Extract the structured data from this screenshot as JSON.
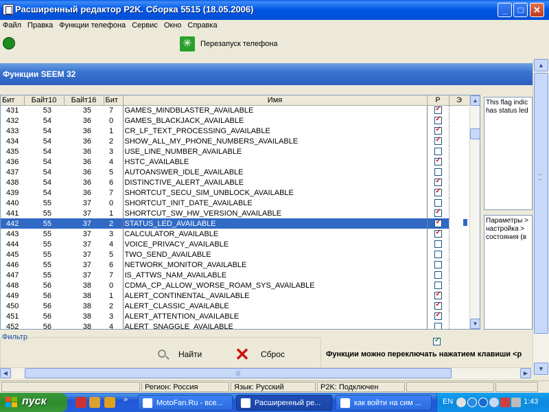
{
  "window": {
    "title": "Расширенный редактор P2K. Сборка 5515 (18.05.2006)",
    "minimize_glyph": "_",
    "maximize_glyph": "□",
    "close_glyph": "✕"
  },
  "menu": [
    "Файл",
    "Правка",
    "Функции телефона",
    "Сервис",
    "Окно",
    "Справка"
  ],
  "toolbar": {
    "restart_label": "Перезапуск телефона"
  },
  "panel_title": "Функции SEEM 32",
  "table": {
    "headers": [
      "Бит",
      "Байт10",
      "Байт16",
      "Бит",
      "Имя",
      "Р",
      "Э"
    ],
    "rows": [
      {
        "bit": "431",
        "byte10": "53",
        "byte16": "35",
        "b": "7",
        "name": "GAMES_MINDBLASTER_AVAILABLE",
        "p": true,
        "e": false
      },
      {
        "bit": "432",
        "byte10": "54",
        "byte16": "36",
        "b": "0",
        "name": "GAMES_BLACKJACK_AVAILABLE",
        "p": true,
        "e": false
      },
      {
        "bit": "433",
        "byte10": "54",
        "byte16": "36",
        "b": "1",
        "name": "CR_LF_TEXT_PROCESSING_AVAILABLE",
        "p": true,
        "e": false
      },
      {
        "bit": "434",
        "byte10": "54",
        "byte16": "36",
        "b": "2",
        "name": "SHOW_ALL_MY_PHONE_NUMBERS_AVAILABLE",
        "p": true,
        "e": false
      },
      {
        "bit": "435",
        "byte10": "54",
        "byte16": "36",
        "b": "3",
        "name": "USE_LINE_NUMBER_AVAILABLE",
        "p": false,
        "e": false
      },
      {
        "bit": "436",
        "byte10": "54",
        "byte16": "36",
        "b": "4",
        "name": "HSTC_AVAILABLE",
        "p": true,
        "e": false
      },
      {
        "bit": "437",
        "byte10": "54",
        "byte16": "36",
        "b": "5",
        "name": "AUTOANSWER_IDLE_AVAILABLE",
        "p": false,
        "e": false
      },
      {
        "bit": "438",
        "byte10": "54",
        "byte16": "36",
        "b": "6",
        "name": "DISTINCTIVE_ALERT_AVAILABLE",
        "p": true,
        "e": false
      },
      {
        "bit": "439",
        "byte10": "54",
        "byte16": "36",
        "b": "7",
        "name": "SHORTCUT_SECU_SIM_UNBLOCK_AVAILABLE",
        "p": true,
        "e": false
      },
      {
        "bit": "440",
        "byte10": "55",
        "byte16": "37",
        "b": "0",
        "name": "SHORTCUT_INIT_DATE_AVAILABLE",
        "p": false,
        "e": false
      },
      {
        "bit": "441",
        "byte10": "55",
        "byte16": "37",
        "b": "1",
        "name": "SHORTCUT_SW_HW_VERSION_AVAILABLE",
        "p": true,
        "e": false
      },
      {
        "bit": "442",
        "byte10": "55",
        "byte16": "37",
        "b": "2",
        "name": "STATUS_LED_AVAILABLE",
        "p": true,
        "e": false,
        "selected": true
      },
      {
        "bit": "443",
        "byte10": "55",
        "byte16": "37",
        "b": "3",
        "name": "CALCULATOR_AVAILABLE",
        "p": true,
        "e": false
      },
      {
        "bit": "444",
        "byte10": "55",
        "byte16": "37",
        "b": "4",
        "name": "VOICE_PRIVACY_AVAILABLE",
        "p": false,
        "e": false
      },
      {
        "bit": "445",
        "byte10": "55",
        "byte16": "37",
        "b": "5",
        "name": "TWO_SEND_AVAILABLE",
        "p": false,
        "e": false
      },
      {
        "bit": "446",
        "byte10": "55",
        "byte16": "37",
        "b": "6",
        "name": "NETWORK_MONITOR_AVAILABLE",
        "p": false,
        "e": false
      },
      {
        "bit": "447",
        "byte10": "55",
        "byte16": "37",
        "b": "7",
        "name": "IS_ATTWS_NAM_AVAILABLE",
        "p": false,
        "e": false
      },
      {
        "bit": "448",
        "byte10": "56",
        "byte16": "38",
        "b": "0",
        "name": "CDMA_CP_ALLOW_WORSE_ROAM_SYS_AVAILABLE",
        "p": false,
        "e": false
      },
      {
        "bit": "449",
        "byte10": "56",
        "byte16": "38",
        "b": "1",
        "name": "ALERT_CONTINENTAL_AVAILABLE",
        "p": true,
        "e": false
      },
      {
        "bit": "450",
        "byte10": "56",
        "byte16": "38",
        "b": "2",
        "name": "ALERT_CLASSIC_AVAILABLE",
        "p": true,
        "e": false
      },
      {
        "bit": "451",
        "byte10": "56",
        "byte16": "38",
        "b": "3",
        "name": "ALERT_ATTENTION_AVAILABLE",
        "p": true,
        "e": false
      },
      {
        "bit": "452",
        "byte10": "56",
        "byte16": "38",
        "b": "4",
        "name": "ALERT_SNAGGLE_AVAILABLE",
        "p": false,
        "e": false
      }
    ]
  },
  "description": {
    "line1": "This flag indic",
    "line2": "has status led"
  },
  "params": {
    "line1": "Параметры >",
    "line2": "настройка >",
    "line3": "состояния (в"
  },
  "filter": {
    "label": "Фильтр",
    "find_label": "Найти",
    "reset_label": "Сброс"
  },
  "bottom_hint": "Функции можно переключать нажатием клавиши <р",
  "statusbar": {
    "region": "Регион: Россия",
    "language": "Язык: Русский",
    "connection": "P2K: Подключен"
  },
  "taskbar": {
    "start_label": "пуск",
    "tasks": [
      "MotoFan.Ru - все...",
      "Расширенный ре...",
      "как войти на сим ..."
    ],
    "lang": "EN",
    "clock": "1:43"
  },
  "colors": {
    "selection": "#316ac5",
    "title_bar": "#0058e6",
    "status_indicator": "#1c8c1c",
    "check_mark": "#cc1010"
  }
}
